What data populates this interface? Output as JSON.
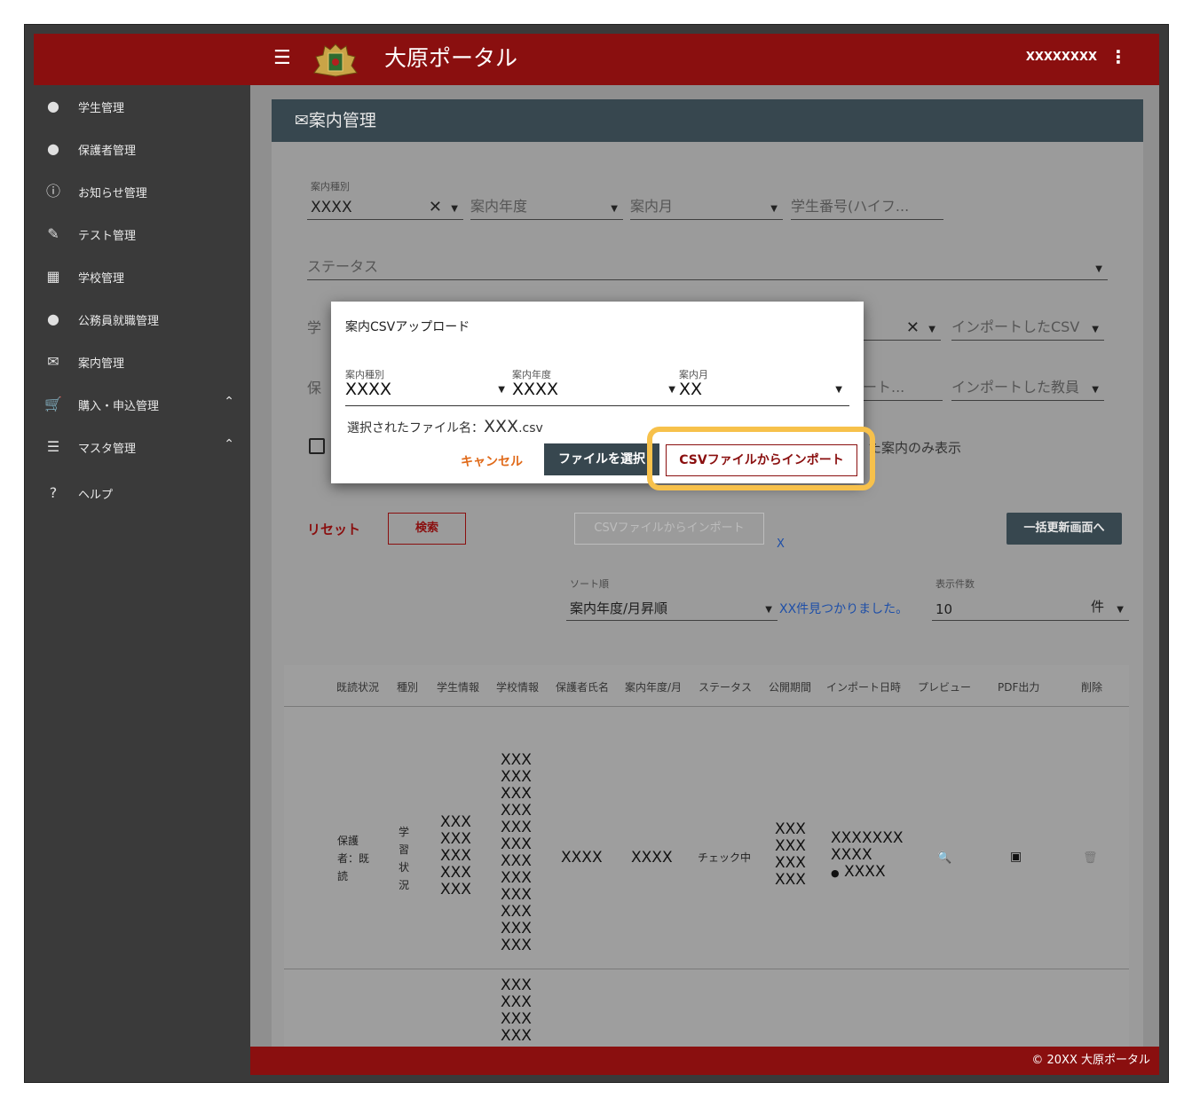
{
  "header": {
    "title": "大原ポータル",
    "user": "XXXXXXXX",
    "more_icon": "more-vertical-icon",
    "menu_icon": "hamburger-icon"
  },
  "sidebar": {
    "items": [
      {
        "label": "学生管理",
        "icon": "person-icon"
      },
      {
        "label": "保護者管理",
        "icon": "person-icon"
      },
      {
        "label": "お知らせ管理",
        "icon": "info-icon"
      },
      {
        "label": "テスト管理",
        "icon": "pencil-icon"
      },
      {
        "label": "学校管理",
        "icon": "building-icon"
      },
      {
        "label": "公務員就職管理",
        "icon": "person-icon"
      },
      {
        "label": "案内管理",
        "icon": "mail-icon"
      },
      {
        "label": "購入・申込管理",
        "icon": "cart-icon"
      },
      {
        "label": "マスタ管理",
        "icon": "list-icon"
      },
      {
        "label": "ヘルプ",
        "icon": "help-icon"
      }
    ]
  },
  "page": {
    "title": "案内管理",
    "filters": {
      "type_label": "案内種別",
      "type_value": "XXXX",
      "year_placeholder": "案内年度",
      "month_placeholder": "案内月",
      "student_no_placeholder": "学生番号(ハイフ...",
      "status_placeholder": "ステータス",
      "school_partial": "学",
      "imported_csv_placeholder": "インポートしたCSV",
      "guardian_partial": "保",
      "right_partial": "ート...",
      "imported_teacher_placeholder": "インポートした教員",
      "checkbox_partial": "た案内のみ表示"
    },
    "buttons": {
      "reset": "リセット",
      "search": "検索",
      "csv_import": "CSVファイルからインポート",
      "csv_clear": "X",
      "bulk_update": "一括更新画面へ"
    },
    "sort": {
      "label": "ソート順",
      "value": "案内年度/月昇順"
    },
    "found_text": "XX件見つかりました。",
    "per_page": {
      "label": "表示件数",
      "value": "10",
      "unit": "件"
    }
  },
  "table": {
    "headers": [
      "既読状況",
      "種別",
      "学生情報",
      "学校情報",
      "保護者氏名",
      "案内年度/月",
      "ステータス",
      "公開期間",
      "インポート日時",
      "プレビュー",
      "PDF出力",
      "削除"
    ],
    "row1": {
      "read_status": "保護者：既読",
      "type": "学習状況",
      "student_info": [
        "XXX",
        "XXX",
        "XXX",
        "XXX",
        "XXX"
      ],
      "school_info": [
        "XXX",
        "XXX",
        "XXX",
        "XXX",
        "XXX",
        "XXX",
        "XXX",
        "XXX",
        "XXX",
        "XXX",
        "XXX",
        "XXX"
      ],
      "guardian_name": "XXXX",
      "year_month": "XXXX",
      "status": "チェック中",
      "period": [
        "XXX",
        "XXX",
        "XXX",
        "XXX"
      ],
      "import_date": "XXXXXXX",
      "import_time": "XXXX",
      "import_user": "XXXX"
    },
    "row2": {
      "school_info": [
        "XXX",
        "XXX",
        "XXX",
        "XXX"
      ]
    }
  },
  "dialog": {
    "title": "案内CSVアップロード",
    "type_label": "案内種別",
    "type_value": "XXXX",
    "year_label": "案内年度",
    "year_value": "XXXX",
    "month_label": "案内月",
    "month_value": "XX",
    "file_prefix": "選択されたファイル名：",
    "file_name": "XXX",
    "file_ext": ".csv",
    "cancel": "キャンセル",
    "choose_file": "ファイルを選択",
    "import": "CSVファイルからインポート"
  },
  "footer": {
    "copyright": "© 20XX 大原ポータル"
  },
  "colors": {
    "brand": "#8a0f0f",
    "header_dark": "#37474f",
    "highlight": "#f7c14b",
    "cancel": "#e06a1a"
  }
}
